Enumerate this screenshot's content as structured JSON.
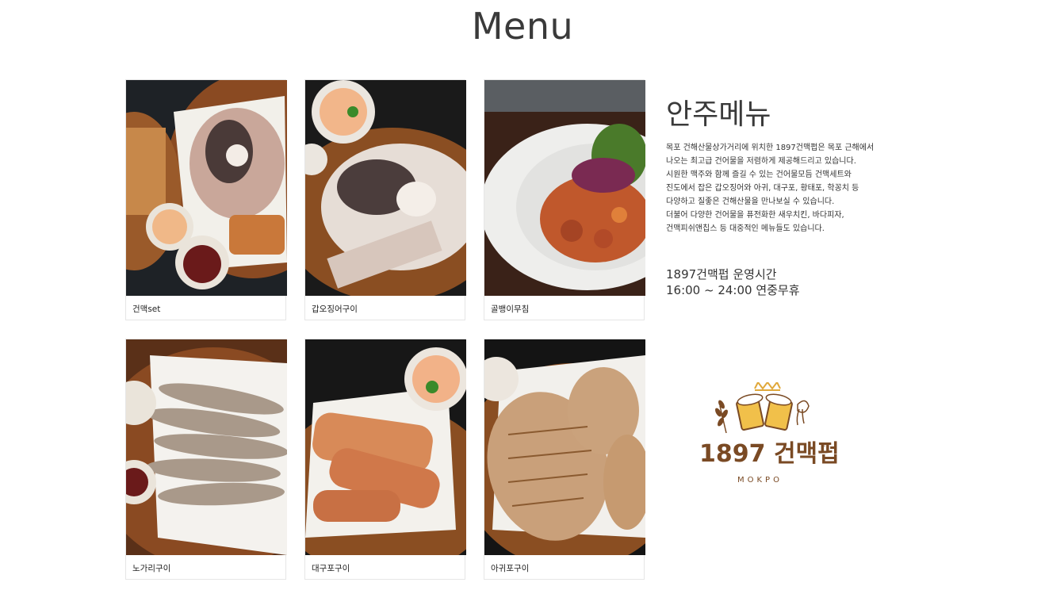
{
  "page": {
    "title": "Menu"
  },
  "menu_items": [
    {
      "name": "건맥set",
      "image": "dried-seafood-platter-photo"
    },
    {
      "name": "갑오징어구이",
      "image": "grilled-cuttlefish-photo"
    },
    {
      "name": "골뱅이무침",
      "image": "spicy-whelk-salad-photo"
    },
    {
      "name": "노가리구이",
      "image": "grilled-dried-pollack-photo"
    },
    {
      "name": "대구포구이",
      "image": "grilled-dried-cod-photo"
    },
    {
      "name": "아귀포구이",
      "image": "grilled-dried-monkfish-photo"
    }
  ],
  "info": {
    "title": "안주메뉴",
    "description": [
      "목포 건해산물상가거리에 위치한 1897건맥펍은 목포 근해에서",
      "나오는 최고급 건어물을 저렴하게 제공해드리고 있습니다.",
      "시원한 맥주와 함께 즐길 수 있는 건어물모듬 건맥세트와",
      "진도에서 잡은 갑오징어와 아귀, 대구포, 황태포, 학꽁치 등",
      "다양하고 질좋은 건해산물을 만나보실 수 있습니다.",
      "더불어 다양한 건어물을 퓨전화한 새우치킨, 바다피자,",
      "건맥피쉬앤칩스 등 대중적인 메뉴들도 있습니다."
    ],
    "hours_title": "1897건맥펍 운영시간",
    "hours": "16:00 ~ 24:00  연중무휴"
  },
  "logo": {
    "name": "1897 건맥펍",
    "tm": "™",
    "sub": "MOKPO",
    "color": "#7a4a24",
    "accent": "#e0a83a"
  }
}
